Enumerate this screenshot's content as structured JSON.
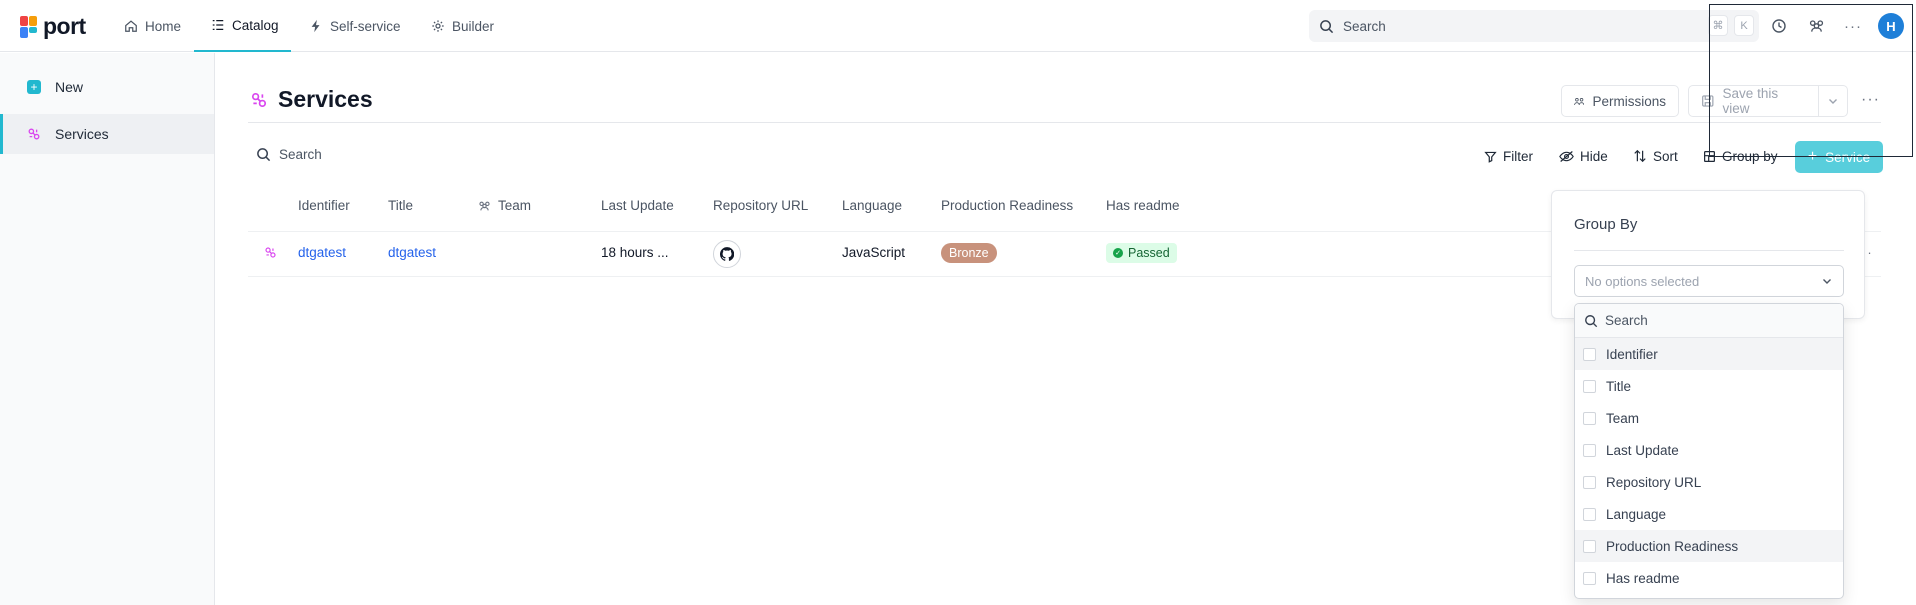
{
  "brand": {
    "name": "port",
    "accent": "#22b8cf"
  },
  "nav": {
    "items": [
      {
        "label": "Home",
        "icon": "home-icon"
      },
      {
        "label": "Catalog",
        "icon": "catalog-icon"
      },
      {
        "label": "Self-service",
        "icon": "lightning-icon"
      },
      {
        "label": "Builder",
        "icon": "gear-icon"
      }
    ],
    "active": "Catalog",
    "search_placeholder": "Search",
    "shortcut": [
      "⌘",
      "K"
    ],
    "avatar_initial": "H"
  },
  "sidebar": {
    "items": [
      {
        "label": "New",
        "icon": "plus-icon"
      },
      {
        "label": "Services",
        "icon": "service-icon"
      }
    ],
    "active": "Services"
  },
  "page": {
    "title": "Services",
    "permissions_label": "Permissions",
    "save_view_label": "Save this view"
  },
  "toolbar": {
    "search_placeholder": "Search",
    "filter_label": "Filter",
    "hide_label": "Hide",
    "sort_label": "Sort",
    "group_by_label": "Group by",
    "add_label": "Service"
  },
  "table": {
    "columns": [
      "Identifier",
      "Title",
      "Team",
      "Last Update",
      "Repository URL",
      "Language",
      "Production Readiness",
      "Has readme"
    ],
    "rows": [
      {
        "identifier": "dtgatest",
        "title": "dtgatest",
        "team": "",
        "last_update": "18 hours ...",
        "repository_icon": "github-icon",
        "language": "JavaScript",
        "production_readiness": "Bronze",
        "has_readme": "Passed"
      }
    ]
  },
  "group_by": {
    "title": "Group By",
    "select_placeholder": "No options selected",
    "search_placeholder": "Search",
    "options": [
      "Identifier",
      "Title",
      "Team",
      "Last Update",
      "Repository URL",
      "Language",
      "Production Readiness",
      "Has readme"
    ]
  },
  "colors": {
    "primary": "#3cc6d6",
    "link": "#2563eb",
    "bronze": "#c8927c",
    "passed_bg": "#dcfce7",
    "avatar": "#1e7fd8"
  }
}
